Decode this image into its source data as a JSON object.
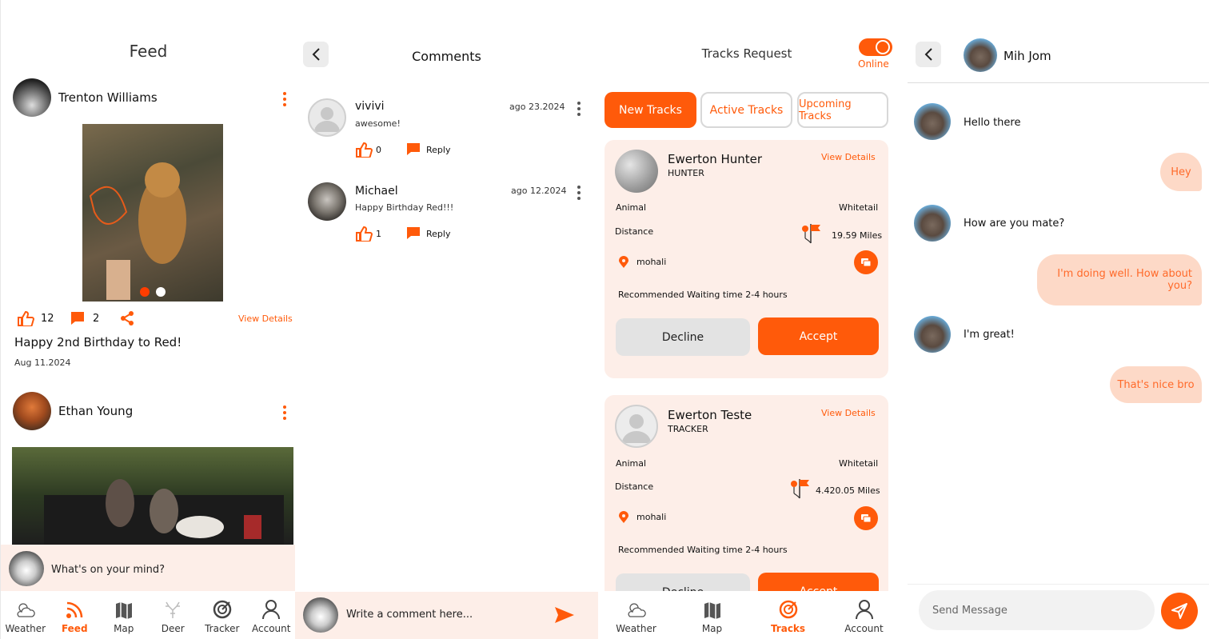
{
  "colors": {
    "accent": "#ff5a0a",
    "peach": "#fdeee8",
    "bubble": "#fdd9c7"
  },
  "feed": {
    "title": "Feed",
    "posts": [
      {
        "author": "Trenton Williams",
        "likes": "12",
        "comments": "2",
        "view_details": "View Details",
        "caption": "Happy 2nd Birthday to Red!",
        "date": "Aug 11.2024"
      },
      {
        "author": "Ethan Young"
      }
    ],
    "composer_placeholder": "What's on your mind?",
    "nav": [
      {
        "label": "Weather",
        "icon": "weather-icon"
      },
      {
        "label": "Feed",
        "icon": "rss-icon",
        "active": true
      },
      {
        "label": "Map",
        "icon": "map-icon"
      },
      {
        "label": "Deer",
        "icon": "deer-icon"
      },
      {
        "label": "Tracker",
        "icon": "tracker-icon"
      },
      {
        "label": "Account",
        "icon": "account-icon"
      }
    ]
  },
  "comments": {
    "title": "Comments",
    "items": [
      {
        "name": "vivivi",
        "text": "awesome!",
        "date": "ago 23.2024",
        "likes": "0",
        "reply": "Reply"
      },
      {
        "name": "Michael",
        "text": "Happy Birthday Red!!!",
        "date": "ago 12.2024",
        "likes": "1",
        "reply": "Reply"
      }
    ],
    "input_placeholder": "Write a comment here..."
  },
  "tracks": {
    "title": "Tracks Request",
    "status": "Online",
    "tabs": [
      "New Tracks",
      "Active Tracks",
      "Upcoming Tracks"
    ],
    "cards": [
      {
        "name": "Ewerton Hunter",
        "role": "HUNTER",
        "view_details": "View Details",
        "animal_label": "Animal",
        "animal": "Whitetail",
        "distance_label": "Distance",
        "distance": "19.59 Miles",
        "location": "mohali",
        "waiting": "Recommended Waiting time 2-4 hours",
        "decline": "Decline",
        "accept": "Accept"
      },
      {
        "name": "Ewerton Teste",
        "role": "TRACKER",
        "view_details": "View Details",
        "animal_label": "Animal",
        "animal": "Whitetail",
        "distance_label": "Distance",
        "distance": "4.420.05 Miles",
        "location": "mohali",
        "waiting": "Recommended Waiting time 2-4 hours",
        "decline": "Decline",
        "accept": "Accept"
      }
    ],
    "nav": [
      {
        "label": "Weather",
        "icon": "weather-icon"
      },
      {
        "label": "Map",
        "icon": "map-icon"
      },
      {
        "label": "Tracks",
        "icon": "tracks-icon",
        "active": true
      },
      {
        "label": "Account",
        "icon": "account-icon"
      }
    ]
  },
  "chat": {
    "contact": "Mih Jom",
    "messages": [
      {
        "from": "them",
        "text": "Hello there"
      },
      {
        "from": "me",
        "text": "Hey"
      },
      {
        "from": "them",
        "text": "How are you mate?"
      },
      {
        "from": "me",
        "text": "I'm doing well. How about you?"
      },
      {
        "from": "them",
        "text": "I'm great!"
      },
      {
        "from": "me",
        "text": "That's nice bro"
      }
    ],
    "input_placeholder": "Send Message"
  }
}
